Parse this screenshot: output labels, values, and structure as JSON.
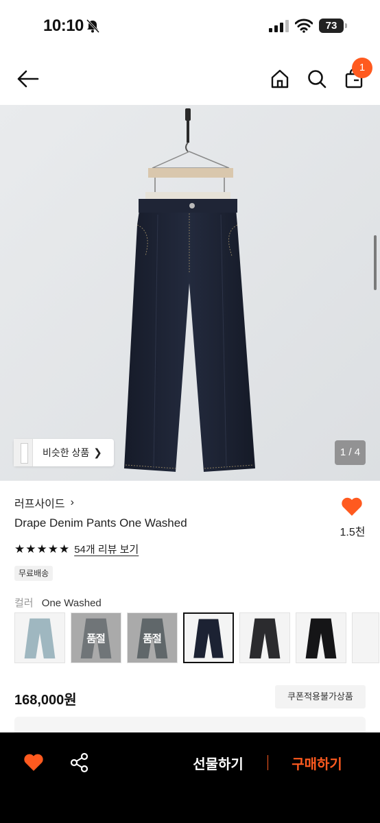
{
  "status_bar": {
    "time": "10:10",
    "battery": "73"
  },
  "header": {
    "back_icon": "back-arrow-icon",
    "home_icon": "home-icon",
    "search_icon": "search-icon",
    "cart_icon": "shopping-bag-icon",
    "cart_count": "1"
  },
  "gallery": {
    "similar_label": "비슷한 상품",
    "page_indicator": "1 / 4"
  },
  "product": {
    "brand": "러프사이드",
    "name": "Drape Denim Pants One Washed",
    "likes": "1.5천",
    "stars": "★★★★★",
    "rating_stars": 5,
    "review_link": "54개 리뷰 보기",
    "shipping_badge": "무료배송",
    "color_label": "컬러",
    "color_value": "One Washed",
    "swatches": [
      {
        "name": "light-wash",
        "sold_out": false
      },
      {
        "name": "gray-wash",
        "sold_out": true,
        "label": "품절"
      },
      {
        "name": "vintage-wash",
        "sold_out": true,
        "label": "품절"
      },
      {
        "name": "one-washed",
        "sold_out": false,
        "selected": true
      },
      {
        "name": "black-wash",
        "sold_out": false
      },
      {
        "name": "black",
        "sold_out": false
      }
    ],
    "price": "168,000원",
    "coupon_badge": "쿠폰적용불가상품"
  },
  "bottom_bar": {
    "gift_label": "선물하기",
    "buy_label": "구매하기"
  },
  "colors": {
    "accent": "#ff5a1f",
    "bottom_bar": "#000000",
    "hero_bg": "#e4e6e8",
    "denim": "#1c2233"
  }
}
